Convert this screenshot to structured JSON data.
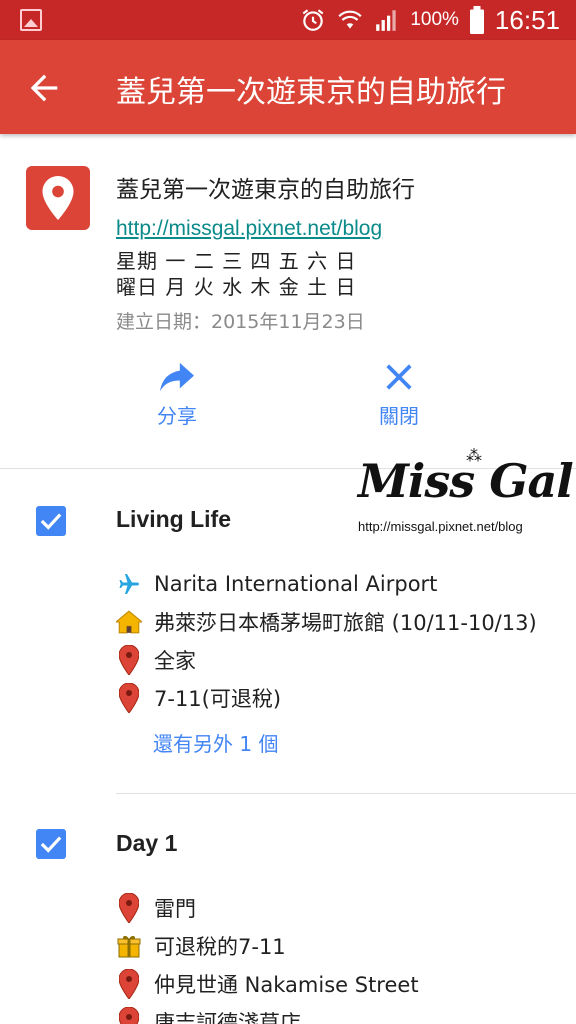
{
  "status_bar": {
    "battery": "100%",
    "time": "16:51"
  },
  "app_bar": {
    "title": "蓋兒第一次遊東京的自助旅行"
  },
  "header": {
    "title": "蓋兒第一次遊東京的自助旅行",
    "link": "http://missgal.pixnet.net/blog",
    "desc_line1": "星期  一 二 三 四 五 六 日",
    "desc_line2": "曜日  月 火 水 木 金 土 日",
    "created": "建立日期：2015年11月23日"
  },
  "actions": {
    "share": "分享",
    "close": "關閉"
  },
  "watermark": {
    "text": "Miss Gal",
    "url": "http://missgal.pixnet.net/blog"
  },
  "layers": [
    {
      "title": "Living Life",
      "checked": true,
      "places": [
        {
          "icon": "airplane-icon",
          "name": "Narita International Airport"
        },
        {
          "icon": "house-icon",
          "name": "弗萊莎日本橋茅場町旅館 (10/11-10/13)"
        },
        {
          "icon": "pin-icon",
          "name": "全家"
        },
        {
          "icon": "pin-icon",
          "name": "7-11(可退稅)"
        }
      ],
      "more": "還有另外 1 個"
    },
    {
      "title": "Day 1",
      "checked": true,
      "places": [
        {
          "icon": "pin-icon",
          "name": "雷門"
        },
        {
          "icon": "gift-icon",
          "name": "可退稅的7-11"
        },
        {
          "icon": "pin-icon",
          "name": "仲見世通 Nakamise Street"
        },
        {
          "icon": "pin-icon",
          "name": "唐吉訶德淺草店"
        }
      ]
    }
  ],
  "colors": {
    "status_bar": "#c62828",
    "app_bar": "#db4437",
    "accent": "#4285f4",
    "pin": "#db4437",
    "house": "#f4b400"
  }
}
